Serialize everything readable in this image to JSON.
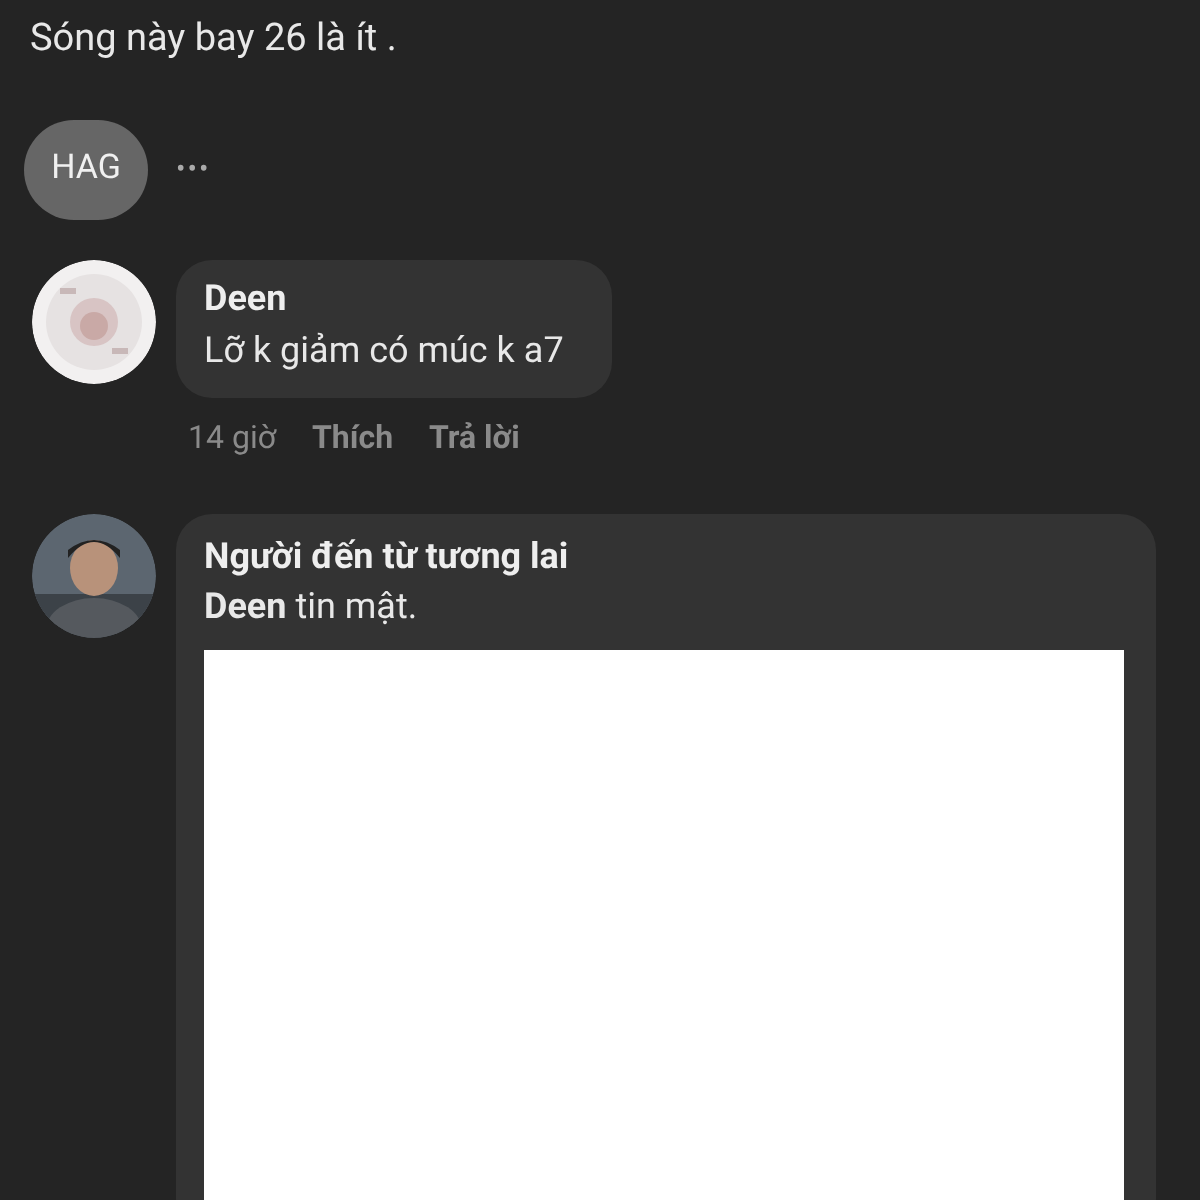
{
  "post_text_tail": "Sóng này bay 26 là ít .",
  "tag_chip": "HAG",
  "more_label": "•••",
  "comments": [
    {
      "author": "Deen",
      "text": "Lỡ k giảm có múc k a7",
      "time": "14 giờ",
      "like": "Thích",
      "reply": "Trả lời"
    },
    {
      "author": "Người đến từ tương lai",
      "mention": "Deen",
      "text": "tin mật.",
      "attachment": {
        "kind": "blank"
      }
    }
  ]
}
